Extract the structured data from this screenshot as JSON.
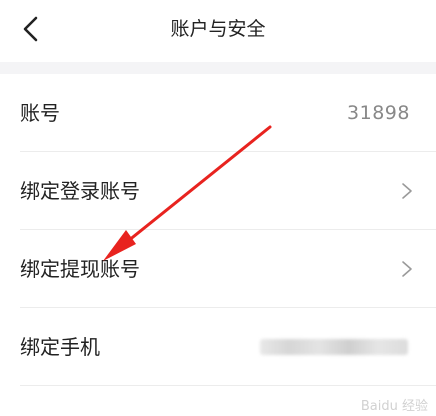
{
  "header": {
    "title": "账户与安全",
    "back_icon": "back-chevron-icon"
  },
  "rows": [
    {
      "label": "账号",
      "value": "31898"
    },
    {
      "label": "绑定登录账号",
      "icon": "chevron-right-icon"
    },
    {
      "label": "绑定提现账号",
      "icon": "chevron-right-icon"
    },
    {
      "label": "绑定手机"
    }
  ],
  "annotation": {
    "color": "#e8231f",
    "points_to": "绑定提现账号"
  },
  "watermark": "Baidu 经验"
}
